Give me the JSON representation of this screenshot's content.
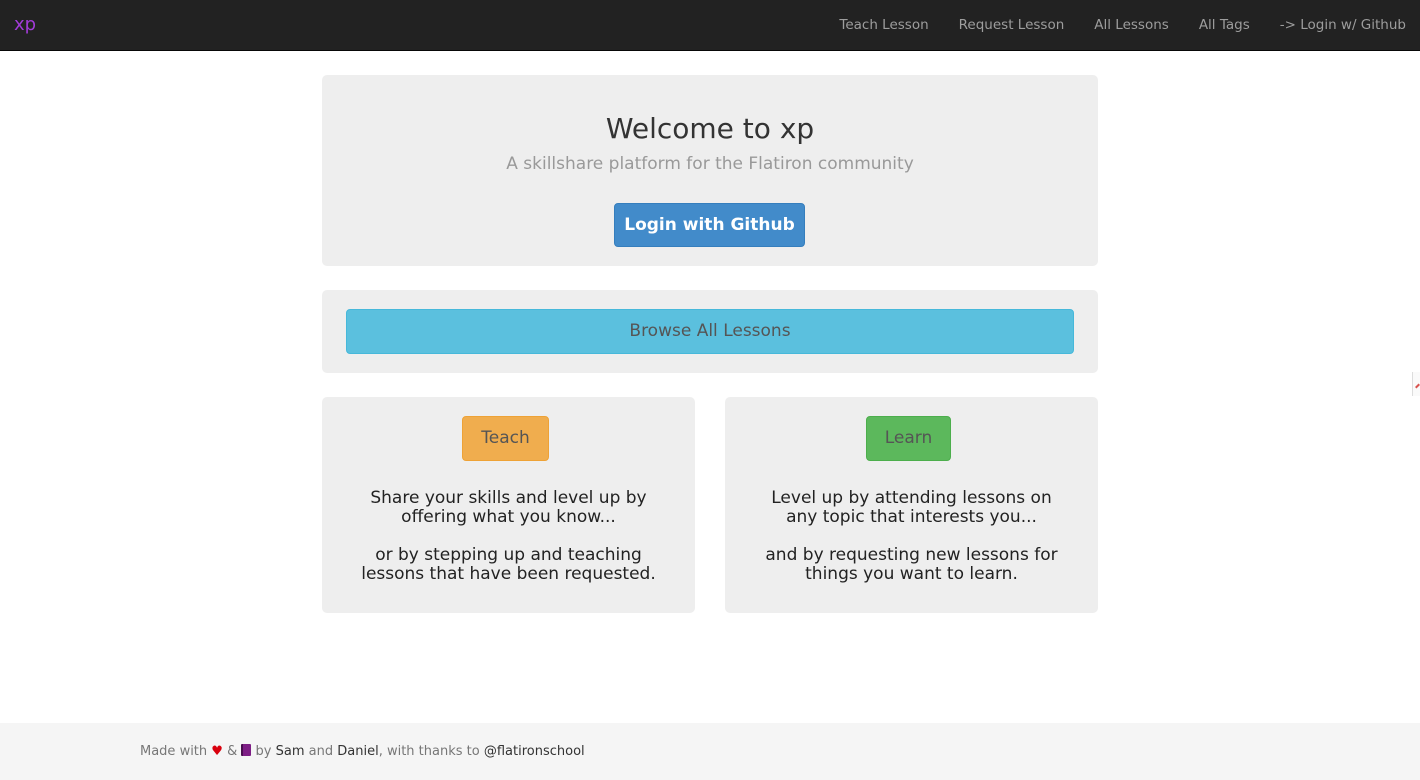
{
  "navbar": {
    "brand": "xp",
    "links": [
      "Teach Lesson",
      "Request Lesson",
      "All Lessons",
      "All Tags",
      "-> Login w/ Github"
    ]
  },
  "hero": {
    "title": "Welcome to xp",
    "subtitle": "A skillshare platform for the Flatiron community",
    "login_button": "Login with Github"
  },
  "browse": {
    "button": "Browse All Lessons"
  },
  "teach": {
    "button": "Teach",
    "text_1": "Share your skills and level up by offering what you know...",
    "text_2": "or by stepping up and teaching lessons that have been requested."
  },
  "learn": {
    "button": "Learn",
    "text_1": "Level up by attending lessons on any topic that interests you...",
    "text_2": "and by requesting new lessons for things you want to learn."
  },
  "footer": {
    "made_with": "Made with",
    "heart_icon": "♥",
    "amp": "&",
    "by": "by",
    "author_1": "Sam",
    "and": "and",
    "author_2": "Daniel",
    "thanks": ", with thanks to",
    "handle": "@flatironschool"
  },
  "colors": {
    "brand": "#a23bd8",
    "navbar_bg": "#222222",
    "primary": "#428bca",
    "info": "#5bc0de",
    "warning": "#f0ad4e",
    "success": "#5cb85c"
  }
}
